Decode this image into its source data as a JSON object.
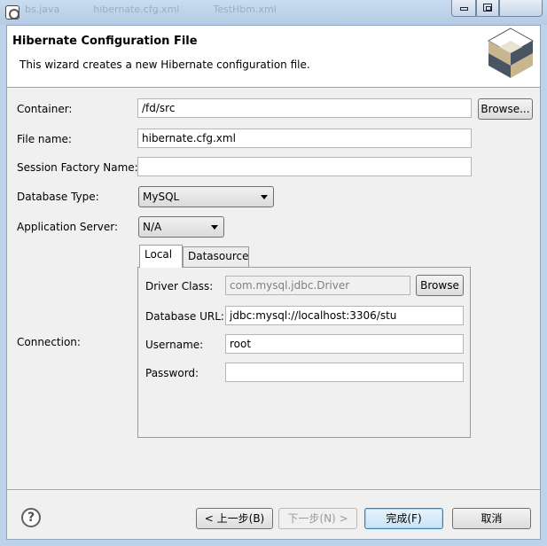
{
  "window": {
    "background_tabs": [
      "bs.java",
      "hibernate.cfg.xml",
      "TestHbm.xml"
    ]
  },
  "banner": {
    "title": "Hibernate Configuration File",
    "description": "This wizard creates a new Hibernate configuration file."
  },
  "form": {
    "container_label": "Container:",
    "container_value": "/fd/src",
    "browse_label": "Browse...",
    "file_name_label": "File name:",
    "file_name_value": "hibernate.cfg.xml",
    "session_factory_label": "Session Factory Name:",
    "session_factory_value": "",
    "database_type_label": "Database Type:",
    "database_type_value": "MySQL",
    "app_server_label": "Application Server:",
    "app_server_value": "N/A",
    "connection_label": "Connection:"
  },
  "connection": {
    "tabs": [
      {
        "label": "Local",
        "active": true
      },
      {
        "label": "Datasource",
        "active": false
      }
    ],
    "driver_class_label": "Driver Class:",
    "driver_class_value": "com.mysql.jdbc.Driver",
    "driver_browse_label": "Browse",
    "database_url_label": "Database URL:",
    "database_url_value": "jdbc:mysql://localhost:3306/stu",
    "username_label": "Username:",
    "username_value": "root",
    "password_label": "Password:",
    "password_value": ""
  },
  "footer": {
    "help_glyph": "?",
    "back_label": "< 上一步(B)",
    "next_label": "下一步(N) >",
    "finish_label": "完成(F)",
    "cancel_label": "取消"
  },
  "colors": {
    "frame": "#bcd3ea",
    "dialog": "#f0f0f0",
    "logo_dark": "#4a5563",
    "logo_tan": "#c8b78e",
    "primary_border": "#3c7fb1"
  }
}
